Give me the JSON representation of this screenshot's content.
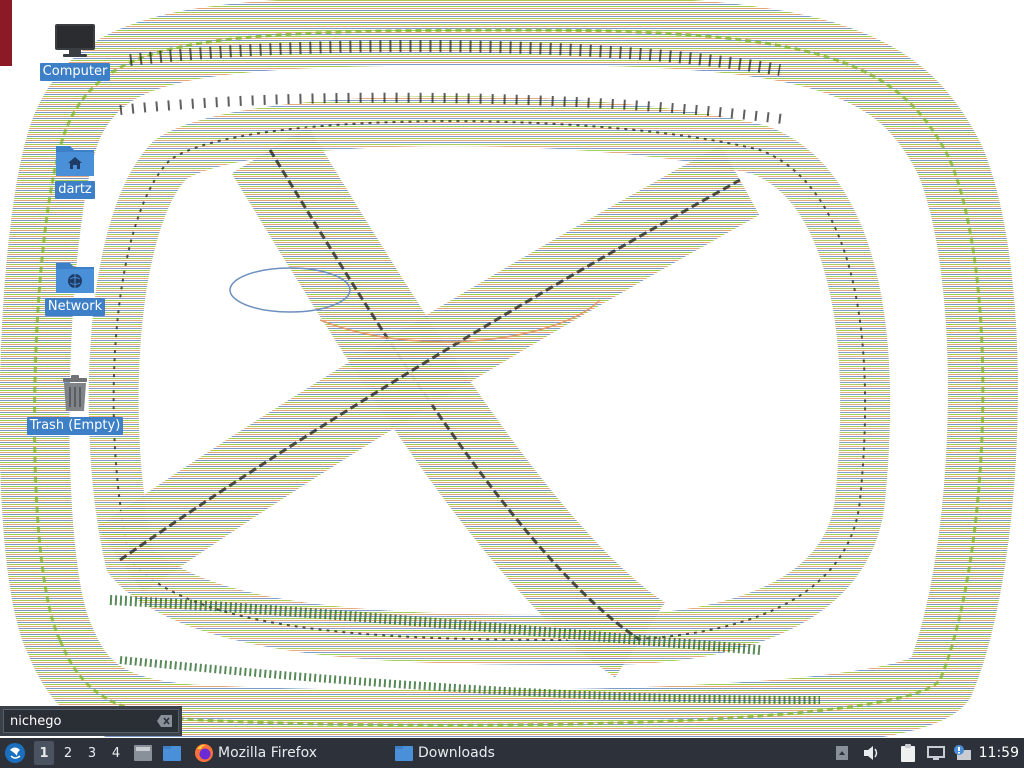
{
  "desktop": {
    "icons": [
      {
        "label": "Computer",
        "icon": "computer-icon"
      },
      {
        "label": "dartz",
        "icon": "home-folder-icon"
      },
      {
        "label": "Network",
        "icon": "network-folder-icon"
      },
      {
        "label": "Trash (Empty)",
        "icon": "trash-icon"
      }
    ],
    "label_color": "#3d80c8"
  },
  "run_dialog": {
    "value": "nichego",
    "clear_icon": "clear-text-icon"
  },
  "taskbar": {
    "menu_icon": "lubuntu-menu-icon",
    "workspaces": [
      "1",
      "2",
      "3",
      "4"
    ],
    "active_workspace": "1",
    "tasks": [
      {
        "label": "Mozilla Firefox",
        "icon": "firefox-icon"
      },
      {
        "label": "Downloads",
        "icon": "folder-icon"
      }
    ],
    "tray_icons": [
      "tray-arrow-icon",
      "volume-icon",
      "clipboard-icon",
      "network-icon",
      "update-notifier-icon"
    ],
    "clock": "11:59",
    "background": "#2d323a"
  }
}
